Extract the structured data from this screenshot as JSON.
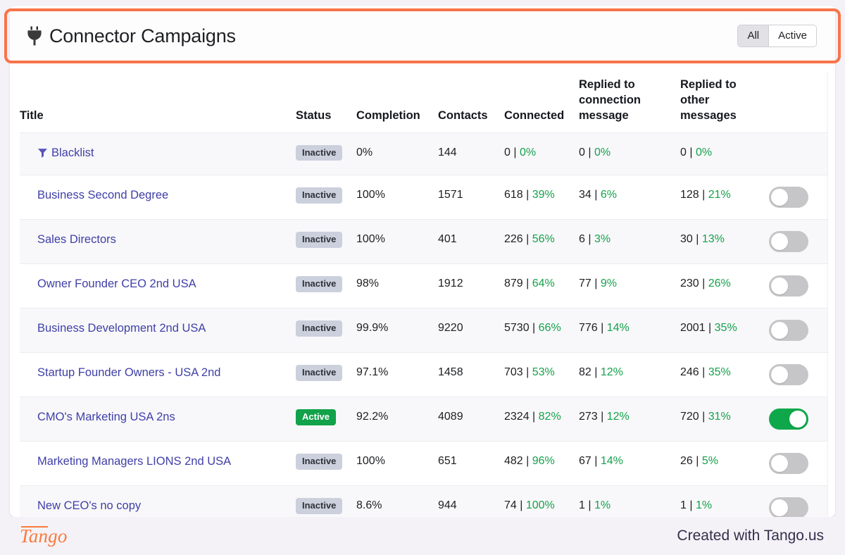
{
  "header": {
    "icon": "plug-icon",
    "title": "Connector Campaigns",
    "filters": [
      {
        "label": "All",
        "selected": true
      },
      {
        "label": "Active",
        "selected": false
      }
    ]
  },
  "table": {
    "columns": {
      "title": "Title",
      "status": "Status",
      "completion": "Completion",
      "contacts": "Contacts",
      "connected": "Connected",
      "replied_connection": "Replied to connection message",
      "replied_other": "Replied to other messages"
    },
    "rows": [
      {
        "title": "Blacklist",
        "has_funnel_icon": true,
        "status": "Inactive",
        "status_state": "inactive",
        "completion": "0%",
        "contacts": "144",
        "connected_count": "0",
        "connected_pct": "0%",
        "replied_connection_count": "0",
        "replied_connection_pct": "0%",
        "replied_other_count": "0",
        "replied_other_pct": "0%",
        "has_toggle": false,
        "toggle_on": false
      },
      {
        "title": "Business Second Degree",
        "has_funnel_icon": false,
        "status": "Inactive",
        "status_state": "inactive",
        "completion": "100%",
        "contacts": "1571",
        "connected_count": "618",
        "connected_pct": "39%",
        "replied_connection_count": "34",
        "replied_connection_pct": "6%",
        "replied_other_count": "128",
        "replied_other_pct": "21%",
        "has_toggle": true,
        "toggle_on": false
      },
      {
        "title": "Sales Directors",
        "has_funnel_icon": false,
        "status": "Inactive",
        "status_state": "inactive",
        "completion": "100%",
        "contacts": "401",
        "connected_count": "226",
        "connected_pct": "56%",
        "replied_connection_count": "6",
        "replied_connection_pct": "3%",
        "replied_other_count": "30",
        "replied_other_pct": "13%",
        "has_toggle": true,
        "toggle_on": false
      },
      {
        "title": "Owner Founder CEO 2nd USA",
        "has_funnel_icon": false,
        "status": "Inactive",
        "status_state": "inactive",
        "completion": "98%",
        "contacts": "1912",
        "connected_count": "879",
        "connected_pct": "64%",
        "replied_connection_count": "77",
        "replied_connection_pct": "9%",
        "replied_other_count": "230",
        "replied_other_pct": "26%",
        "has_toggle": true,
        "toggle_on": false
      },
      {
        "title": "Business Development 2nd USA",
        "has_funnel_icon": false,
        "status": "Inactive",
        "status_state": "inactive",
        "completion": "99.9%",
        "contacts": "9220",
        "connected_count": "5730",
        "connected_pct": "66%",
        "replied_connection_count": "776",
        "replied_connection_pct": "14%",
        "replied_other_count": "2001",
        "replied_other_pct": "35%",
        "has_toggle": true,
        "toggle_on": false
      },
      {
        "title": "Startup Founder Owners - USA 2nd",
        "has_funnel_icon": false,
        "status": "Inactive",
        "status_state": "inactive",
        "completion": "97.1%",
        "contacts": "1458",
        "connected_count": "703",
        "connected_pct": "53%",
        "replied_connection_count": "82",
        "replied_connection_pct": "12%",
        "replied_other_count": "246",
        "replied_other_pct": "35%",
        "has_toggle": true,
        "toggle_on": false
      },
      {
        "title": "CMO's Marketing USA 2ns",
        "has_funnel_icon": false,
        "status": "Active",
        "status_state": "active",
        "completion": "92.2%",
        "contacts": "4089",
        "connected_count": "2324",
        "connected_pct": "82%",
        "replied_connection_count": "273",
        "replied_connection_pct": "12%",
        "replied_other_count": "720",
        "replied_other_pct": "31%",
        "has_toggle": true,
        "toggle_on": true
      },
      {
        "title": "Marketing Managers LIONS 2nd USA",
        "has_funnel_icon": false,
        "status": "Inactive",
        "status_state": "inactive",
        "completion": "100%",
        "contacts": "651",
        "connected_count": "482",
        "connected_pct": "96%",
        "replied_connection_count": "67",
        "replied_connection_pct": "14%",
        "replied_other_count": "26",
        "replied_other_pct": "5%",
        "has_toggle": true,
        "toggle_on": false
      },
      {
        "title": "New CEO's no copy",
        "has_funnel_icon": false,
        "status": "Inactive",
        "status_state": "inactive",
        "completion": "8.6%",
        "contacts": "944",
        "connected_count": "74",
        "connected_pct": "100%",
        "replied_connection_count": "1",
        "replied_connection_pct": "1%",
        "replied_other_count": "1",
        "replied_other_pct": "1%",
        "has_toggle": true,
        "toggle_on": false
      }
    ],
    "separator": "|"
  },
  "footer": {
    "logo": "Tango",
    "note": "Created with Tango.us"
  }
}
